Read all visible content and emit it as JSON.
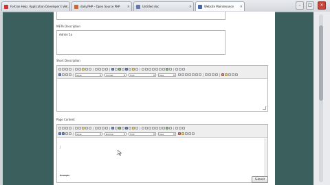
{
  "browser": {
    "tabs": [
      {
        "label": "Fortran Help: Application Developer's Ver...",
        "favicon": "#cc3333",
        "active": false
      },
      {
        "label": "daily.PHP – Open Source PHP",
        "favicon": "#cc6633",
        "active": false
      },
      {
        "label": "Untitled doc",
        "favicon": "#6677aa",
        "active": false
      },
      {
        "label": "Website Maintenance",
        "favicon": "#4466aa",
        "active": true
      }
    ],
    "window_buttons": [
      "–",
      "□",
      "×"
    ]
  },
  "form": {
    "meta_description": {
      "label": "META Description",
      "value": "Admin 5a"
    },
    "short_description": {
      "label": "Short Description"
    },
    "page_content": {
      "label": "Page Content",
      "body_text": "Example"
    },
    "format_values": {
      "style": "Style",
      "format": "Format",
      "normal": "Normal",
      "font": "Font",
      "size": "Size"
    },
    "submit_label": "Submit"
  }
}
